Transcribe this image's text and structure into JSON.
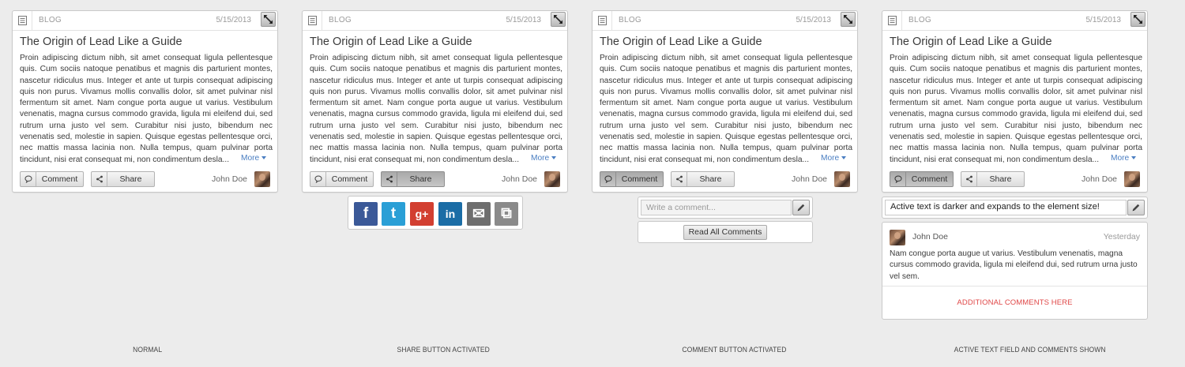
{
  "post": {
    "category": "BLOG",
    "date": "5/15/2013",
    "title": "The Origin of Lead Like a Guide",
    "body": "Proin adipiscing dictum nibh, sit amet consequat ligula pellentesque quis. Cum sociis natoque penatibus et magnis dis parturient montes, nascetur ridiculus mus. Integer et ante ut turpis consequat adipiscing quis non purus. Vivamus mollis convallis dolor, sit amet pulvinar nisl fermentum sit amet. Nam congue porta augue ut varius. Vestibulum venenatis, magna cursus commodo gravida, ligula mi eleifend dui, sed rutrum urna justo vel sem. Curabitur nisi justo, bibendum nec venenatis sed, molestie in sapien. Quisque egestas pellentesque orci, nec mattis massa lacinia non. Nulla tempus, quam pulvinar porta tincidunt, nisi erat consequat mi, non condimentum desla...",
    "more_label": "More",
    "comment_label": "Comment",
    "share_label": "Share",
    "author": "John Doe"
  },
  "share_panel": {
    "icons": [
      {
        "name": "facebook-icon",
        "glyph": "f",
        "color": "#3b5998"
      },
      {
        "name": "twitter-icon",
        "glyph": "t",
        "color": "#2a9fd6"
      },
      {
        "name": "google-plus-icon",
        "glyph": "g+",
        "color": "#d23f31"
      },
      {
        "name": "linkedin-icon",
        "glyph": "in",
        "color": "#1b6da6"
      },
      {
        "name": "email-icon",
        "glyph": "✉",
        "color": "#6e6e6e"
      },
      {
        "name": "copy-link-icon",
        "glyph": "⧉",
        "color": "#8a8a8a"
      }
    ]
  },
  "comment_box": {
    "placeholder": "Write a comment...",
    "read_all_label": "Read All Comments",
    "active_text": "Active text is darker and expands to the element size!"
  },
  "comments": {
    "items": [
      {
        "author": "John Doe",
        "time": "Yesterday",
        "text": "Nam congue porta augue ut varius. Vestibulum venenatis, magna cursus commodo gravida, ligula mi eleifend dui, sed rutrum urna justo vel sem."
      }
    ],
    "additional_label": "ADDITIONAL COMMENTS HERE"
  },
  "captions": {
    "normal": "NORMAL",
    "share_active": "SHARE BUTTON ACTIVATED",
    "comment_active": "COMMENT BUTTON ACTIVATED",
    "text_active": "ACTIVE TEXT FIELD AND COMMENTS SHOWN"
  },
  "colors": {
    "accent_link": "#4a7ec2",
    "additional_comments": "#e04848"
  }
}
